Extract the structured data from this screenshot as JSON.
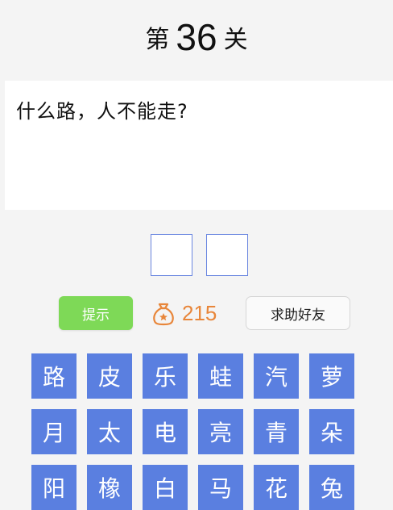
{
  "header": {
    "prefix": "第",
    "level": "36",
    "suffix": "关"
  },
  "question": "什么路，人不能走?",
  "controls": {
    "hint_label": "提示",
    "coins": "215",
    "help_label": "求助好友",
    "coin_icon": "money-bag-icon",
    "accent_green": "#7ed957",
    "accent_orange": "#e8863a"
  },
  "answer_slots": [
    "",
    ""
  ],
  "keyboard": {
    "key_color": "#5a7fe0",
    "rows": [
      [
        "路",
        "皮",
        "乐",
        "蛙",
        "汽",
        "萝"
      ],
      [
        "月",
        "太",
        "电",
        "亮",
        "青",
        "朵"
      ],
      [
        "阳",
        "橡",
        "白",
        "马",
        "花",
        "兔"
      ]
    ]
  }
}
